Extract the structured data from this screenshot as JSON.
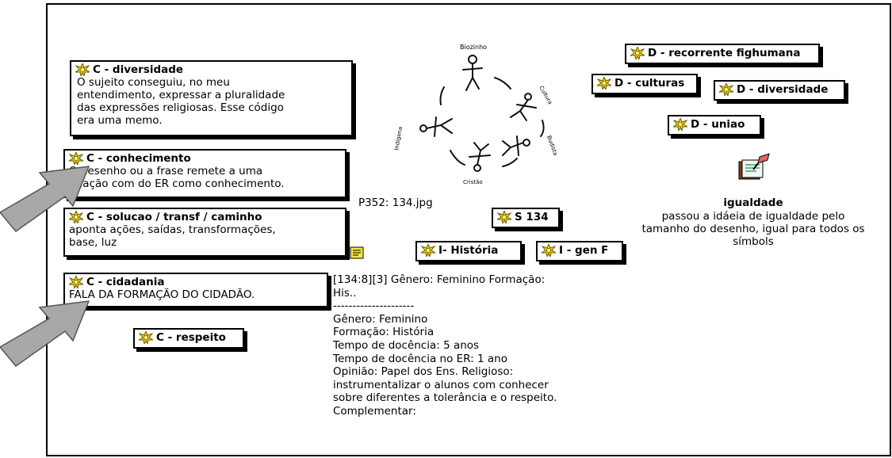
{
  "codes_left": [
    {
      "title": "C - diversidade",
      "lines": [
        "O sujeito conseguiu, no meu",
        "entendimento, expressar a pluralidade",
        "das expressões religiosas. Esse código",
        "era uma memo."
      ]
    },
    {
      "title": "C - conhecimento",
      "lines": [
        "O desenho ou a frase remete a uma",
        "relação com do ER como conhecimento."
      ]
    },
    {
      "title": "C - solucao / transf / caminho",
      "lines": [
        "aponta ações, saídas, transformações,",
        "base, luz"
      ]
    },
    {
      "title": "C - cidadania",
      "lines": [
        "FALA DA FORMAÇÃO DO CIDADÃO."
      ]
    },
    {
      "title": "C - respeito",
      "lines": []
    }
  ],
  "codes_right": {
    "recorrente": "D - recorrente fighumana",
    "culturas": "D - culturas",
    "diversidade": "D - diversidade",
    "uniao": "D - uniao"
  },
  "codes_middle": {
    "s134": "S 134",
    "historia": "I- História",
    "genf": "I - gen F"
  },
  "image_caption": "P352: 134.jpg",
  "memo": {
    "title": "igualdade",
    "lines": [
      "passou a idáeia de igualdade pelo",
      "tamanho do desenho, igual para todos os",
      "símbols"
    ]
  },
  "quotation": {
    "header": [
      "[134:8][3] Gênero: Feminino Formação:",
      "His.."
    ],
    "separator": "---------------------",
    "lines": [
      "Gênero: Feminino",
      "Formação: História",
      "Tempo de docência: 5 anos",
      "Tempo de docência no ER: 1 ano",
      "Opinião: Papel dos Ens. Religioso:",
      "instrumentalizar  o alunos com conhecer",
      "sobre diferentes a tolerância e o respeito.",
      "Complementar:"
    ]
  },
  "drawing_labels": [
    "Biozinho",
    "Cultura",
    "Budista",
    "Cristão",
    "Indígena"
  ],
  "colors": {
    "star_fill": "#f2d200",
    "star_stroke": "#6b5a00",
    "arrow": "#9a9a9a"
  }
}
